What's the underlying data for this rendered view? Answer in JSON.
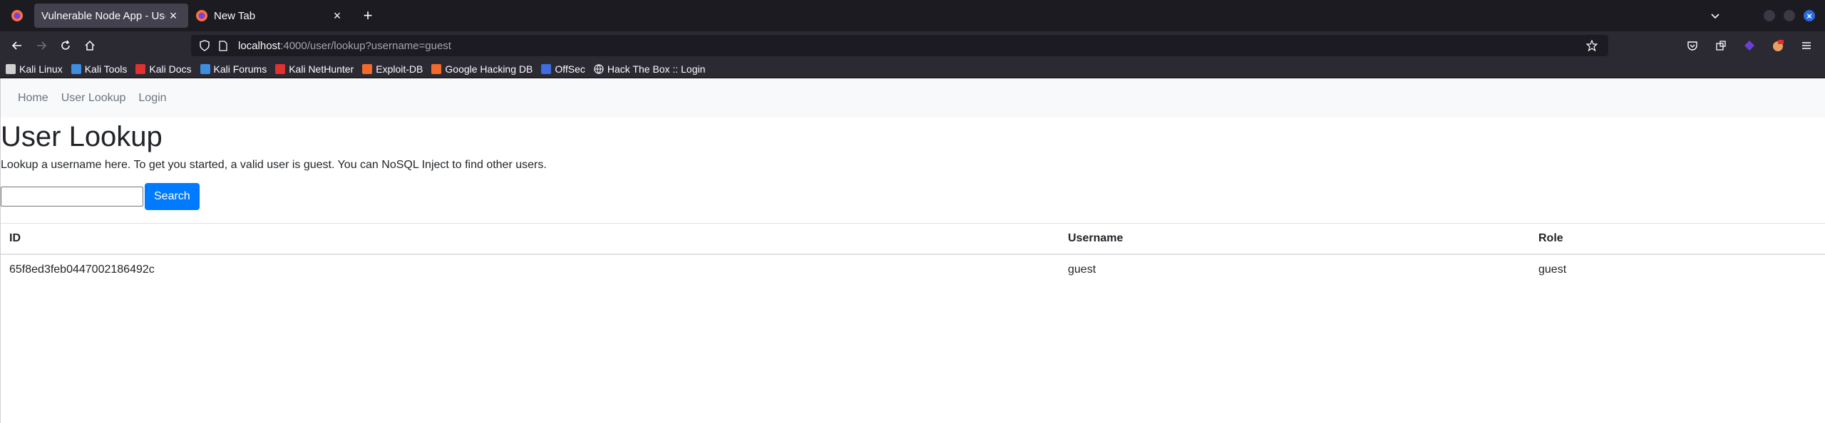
{
  "browser": {
    "tabs": [
      {
        "title": "Vulnerable Node App - User L",
        "active": true
      },
      {
        "title": "New Tab",
        "active": false
      }
    ],
    "url": {
      "host": "localhost",
      "rest": ":4000/user/lookup?username=guest"
    },
    "bookmarks": [
      {
        "label": "Kali Linux",
        "icon": "kali-icon",
        "color": "#d0d0d0"
      },
      {
        "label": "Kali Tools",
        "icon": "kali-tools-icon",
        "color": "#3d8de0"
      },
      {
        "label": "Kali Docs",
        "icon": "kali-docs-icon",
        "color": "#e0312f"
      },
      {
        "label": "Kali Forums",
        "icon": "kali-forums-icon",
        "color": "#3d8de0"
      },
      {
        "label": "Kali NetHunter",
        "icon": "nethunter-icon",
        "color": "#e0312f"
      },
      {
        "label": "Exploit-DB",
        "icon": "exploitdb-icon",
        "color": "#f36a2a"
      },
      {
        "label": "Google Hacking DB",
        "icon": "ghdb-icon",
        "color": "#f36a2a"
      },
      {
        "label": "OffSec",
        "icon": "offsec-icon",
        "color": "#3d6de0"
      },
      {
        "label": "Hack The Box :: Login",
        "icon": "globe-icon",
        "color": "#fbfbfe"
      }
    ]
  },
  "page": {
    "nav": [
      "Home",
      "User Lookup",
      "Login"
    ],
    "title": "User Lookup",
    "lead": "Lookup a username here. To get you started, a valid user is guest. You can NoSQL Inject to find other users.",
    "search": {
      "value": "",
      "button": "Search"
    },
    "table": {
      "headers": [
        "ID",
        "Username",
        "Role"
      ],
      "rows": [
        [
          "65f8ed3feb0447002186492c",
          "guest",
          "guest"
        ]
      ]
    }
  }
}
